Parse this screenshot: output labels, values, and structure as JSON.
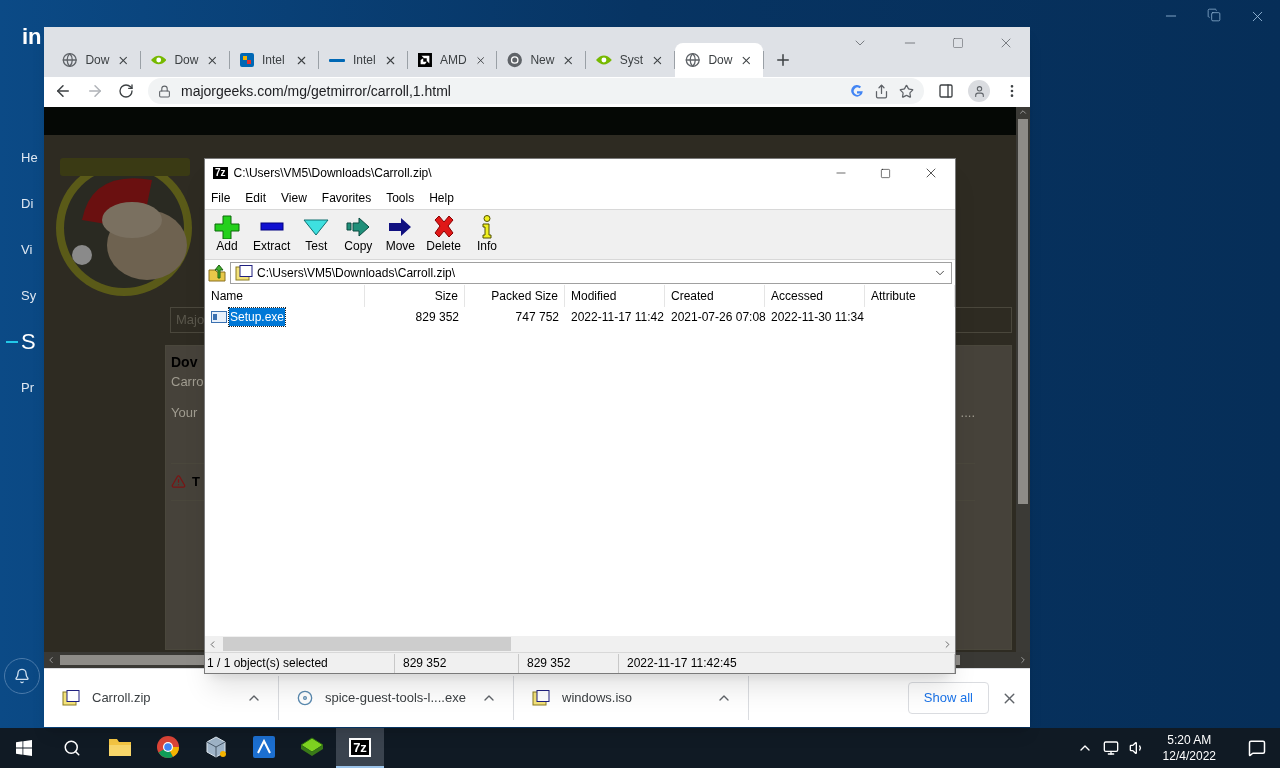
{
  "background_app": {
    "logo": "in",
    "nav": [
      {
        "label": "He",
        "selected": false
      },
      {
        "label": "Di",
        "selected": false
      },
      {
        "label": "Vi",
        "selected": false
      },
      {
        "label": "Sy",
        "selected": false
      },
      {
        "label": "S",
        "selected": true
      },
      {
        "label": "Pr",
        "selected": false
      }
    ]
  },
  "browser": {
    "tabs": [
      {
        "title": "Dow",
        "selected": false
      },
      {
        "title": "Dow",
        "selected": false
      },
      {
        "title": "Intel",
        "selected": false
      },
      {
        "title": "Intel",
        "selected": false
      },
      {
        "title": "AMD",
        "selected": false
      },
      {
        "title": "New",
        "selected": false
      },
      {
        "title": "Syst",
        "selected": false
      },
      {
        "title": "Dow",
        "selected": true
      }
    ],
    "url": "majorgeeks.com/mg/getmirror/carroll,1.html",
    "page": {
      "search_placeholder": "Majo",
      "heading": "Dov",
      "subtitle": "Carro",
      "text": "Your",
      "trailing_text": "....",
      "warning": "T"
    },
    "downloads": [
      {
        "name": "Carroll.zip"
      },
      {
        "name": "spice-guest-tools-l....exe"
      },
      {
        "name": "windows.iso"
      }
    ],
    "show_all": "Show all"
  },
  "archive_window": {
    "icon_text": "7z",
    "title": "C:\\Users\\VM5\\Downloads\\Carroll.zip\\",
    "menu": [
      "File",
      "Edit",
      "View",
      "Favorites",
      "Tools",
      "Help"
    ],
    "toolbar": [
      "Add",
      "Extract",
      "Test",
      "Copy",
      "Move",
      "Delete",
      "Info"
    ],
    "path": "C:\\Users\\VM5\\Downloads\\Carroll.zip\\",
    "columns": [
      "Name",
      "Size",
      "Packed Size",
      "Modified",
      "Created",
      "Accessed",
      "Attribute"
    ],
    "rows": [
      {
        "cells": [
          "Setup.exe",
          "829 352",
          "747 752",
          "2022-11-17 11:42",
          "2021-07-26 07:08",
          "2022-11-30 11:34"
        ],
        "selected": true
      }
    ],
    "status": [
      "1 / 1 object(s) selected",
      "829 352",
      "829 352",
      "2022-11-17 11:42:45"
    ]
  },
  "taskbar": {
    "apps": [
      {
        "selected": false
      },
      {
        "selected": false
      },
      {
        "selected": false
      },
      {
        "selected": false
      },
      {
        "selected": false
      },
      {
        "label": "7z",
        "selected": true
      }
    ],
    "time": "5:20 AM",
    "date": "12/4/2022"
  }
}
